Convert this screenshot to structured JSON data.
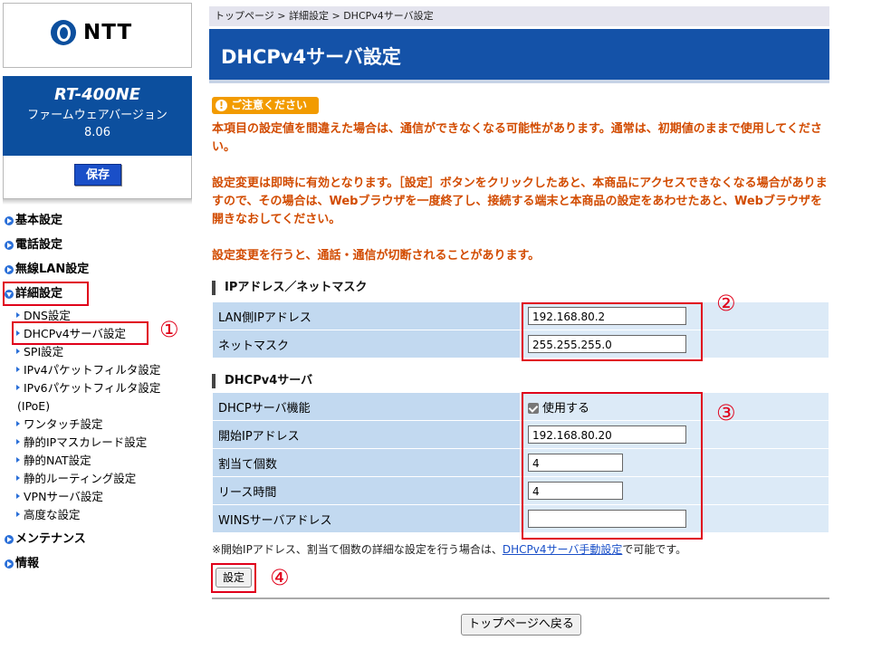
{
  "sidebar": {
    "logo_text": "NTT",
    "model": "RT-400NE",
    "firmware_label": "ファームウェアバージョン",
    "firmware_version": "8.06",
    "save_label": "保存",
    "nav": [
      {
        "label": "基本設定",
        "expanded": false
      },
      {
        "label": "電話設定",
        "expanded": false
      },
      {
        "label": "無線LAN設定",
        "expanded": false
      },
      {
        "label": "詳細設定",
        "expanded": true
      }
    ],
    "sub_items": [
      "DNS設定",
      "DHCPv4サーバ設定",
      "SPI設定",
      "IPv4パケットフィルタ設定",
      "IPv6パケットフィルタ設定",
      "(IPoE)",
      "ワンタッチ設定",
      "静的IPマスカレード設定",
      "静的NAT設定",
      "静的ルーティング設定",
      "VPNサーバ設定",
      "高度な設定"
    ],
    "nav_bottom": [
      {
        "label": "メンテナンス"
      },
      {
        "label": "情報"
      }
    ]
  },
  "breadcrumb": "トップページ > 詳細設定 > DHCPv4サーバ設定",
  "page_title": "DHCPv4サーバ設定",
  "caution_label": "ご注意ください",
  "warnings": [
    "本項目の設定値を間違えた場合は、通信ができなくなる可能性があります。通常は、初期値のままで使用してください。",
    "設定変更は即時に有効となります。［設定］ボタンをクリックしたあと、本商品にアクセスできなくなる場合がありますので、その場合は、Webブラウザを一度終了し、接続する端末と本商品の設定をあわせたあと、Webブラウザを開きなおしてください。",
    "設定変更を行うと、通話・通信が切断されることがあります。"
  ],
  "section_ip": {
    "heading": "IPアドレス／ネットマスク",
    "rows": [
      {
        "label": "LAN側IPアドレス",
        "value": "192.168.80.2"
      },
      {
        "label": "ネットマスク",
        "value": "255.255.255.0"
      }
    ]
  },
  "section_dhcp": {
    "heading": "DHCPv4サーバ",
    "function_label": "DHCPサーバ機能",
    "function_checkbox_label": "使用する",
    "function_checked": true,
    "rows": [
      {
        "label": "開始IPアドレス",
        "value": "192.168.80.20"
      },
      {
        "label": "割当て個数",
        "value": "4"
      },
      {
        "label": "リース時間",
        "value": "4"
      },
      {
        "label": "WINSサーバアドレス",
        "value": ""
      }
    ]
  },
  "note_prefix": "※開始IPアドレス、割当て個数の詳細な設定を行う場合は、",
  "note_link": "DHCPv4サーバ手動設定",
  "note_suffix": "で可能です。",
  "set_button": "設定",
  "back_button": "トップページへ戻る",
  "annotations": [
    "①",
    "②",
    "③",
    "④"
  ],
  "colors": {
    "accent": "#1452a8",
    "warning_text": "#d24b00",
    "caution_bg": "#f29b00",
    "annotation_red": "#e0001a"
  }
}
